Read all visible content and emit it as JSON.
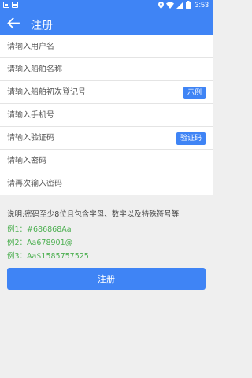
{
  "status_bar": {
    "time": "3:53"
  },
  "header": {
    "title": "注册",
    "back_icon": "arrow-left-icon"
  },
  "form": {
    "username_placeholder": "请输入用户名",
    "ship_name_placeholder": "请输入船舶名称",
    "registration_no_placeholder": "请输入船舶初次登记号",
    "example_button": "示例",
    "phone_placeholder": "请输入手机号",
    "code_placeholder": "请输入验证码",
    "code_button": "验证码",
    "password_placeholder": "请输入密码",
    "password_confirm_placeholder": "请再次输入密码"
  },
  "notes": {
    "description": "说明:密码至少8位且包含字母、数字以及特殊符号等",
    "examples": [
      {
        "label": "例1：",
        "value": "#686868Aa"
      },
      {
        "label": "例2：",
        "value": "Aa678901@"
      },
      {
        "label": "例3：",
        "value": "Aa$1585757525"
      }
    ]
  },
  "register_button": "注册",
  "colors": {
    "primary": "#3f84f5",
    "example_text": "#4caf50",
    "background": "#efefef"
  }
}
